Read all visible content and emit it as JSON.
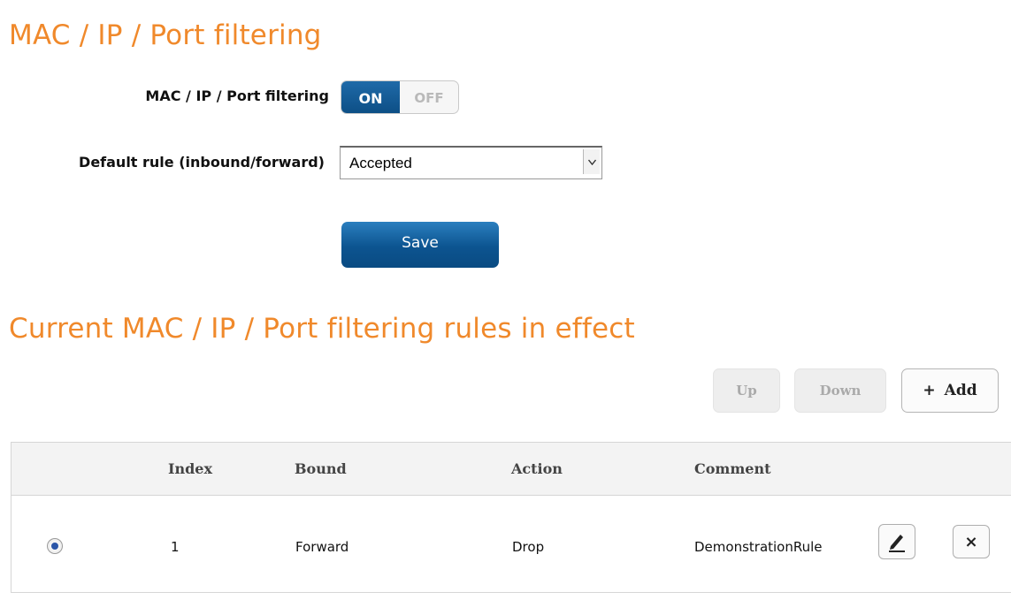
{
  "page": {
    "title": "MAC / IP / Port filtering",
    "rules_title": "Current MAC / IP / Port filtering rules in effect"
  },
  "form": {
    "filtering_label": "MAC / IP / Port filtering",
    "toggle_on": "ON",
    "toggle_off": "OFF",
    "toggle_state": "on",
    "default_rule_label": "Default rule (inbound/forward)",
    "default_rule_value": "Accepted",
    "save_label": "Save"
  },
  "toolbar": {
    "up_label": "Up",
    "down_label": "Down",
    "add_plus": "+",
    "add_label": "Add",
    "up_enabled": false,
    "down_enabled": false
  },
  "table": {
    "headers": [
      "Index",
      "Bound",
      "Action",
      "Comment"
    ],
    "rows": [
      {
        "selected": true,
        "index": "1",
        "bound": "Forward",
        "action": "Drop",
        "comment": "DemonstrationRule",
        "edit_icon": "pencil-icon",
        "delete_icon": "close-icon",
        "delete_glyph": "×"
      }
    ]
  },
  "colors": {
    "heading_orange": "#f0892b",
    "primary_blue": "#0c5490",
    "radio_dot": "#2a55a8"
  }
}
